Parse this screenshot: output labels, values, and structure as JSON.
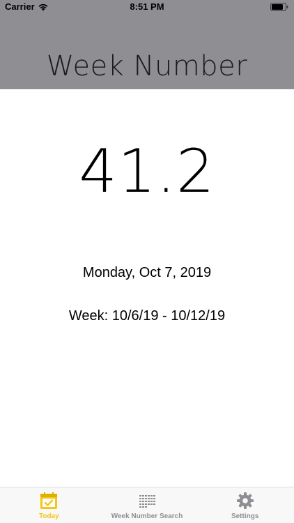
{
  "status_bar": {
    "carrier": "Carrier",
    "time": "8:51 PM"
  },
  "header": {
    "title": "Week Number",
    "background_color": "#8e8e93"
  },
  "main": {
    "week_number": "41.2",
    "date": "Monday, Oct 7, 2019",
    "week_range": "Week: 10/6/19 - 10/12/19"
  },
  "tab_bar": {
    "active_color": "#f5c518",
    "inactive_color": "#8e8e93",
    "tabs": [
      {
        "label": "Today",
        "icon": "calendar-check-icon",
        "active": true
      },
      {
        "label": "Week Number Search",
        "icon": "calendar-grid-icon",
        "active": false
      },
      {
        "label": "Settings",
        "icon": "gear-icon",
        "active": false
      }
    ]
  }
}
